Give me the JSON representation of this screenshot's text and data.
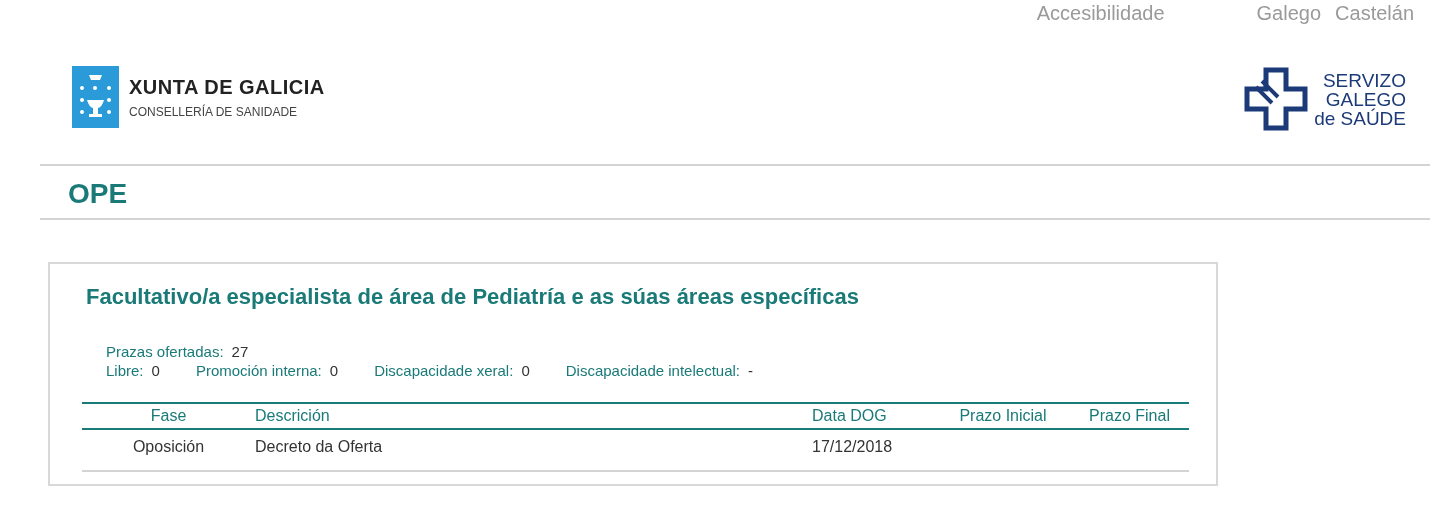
{
  "top_links": [
    {
      "label": "Accesibilidade"
    },
    {
      "label": "Galego"
    },
    {
      "label": "Castelán"
    }
  ],
  "logo_left": {
    "title": "XUNTA DE GALICIA",
    "subtitle": "CONSELLERÍA DE SANIDADE"
  },
  "logo_right": {
    "lines": [
      "SERVIZO",
      "GALEGO",
      "de SAÚDE"
    ]
  },
  "page_title": "OPE",
  "card": {
    "title": "Facultativo/a especialista de área de Pediatría e as súas áreas específicas",
    "summary": [
      {
        "label": "Prazas ofertadas:",
        "value": "27"
      }
    ],
    "counts": [
      {
        "label": "Libre:",
        "value": "0"
      },
      {
        "label": "Promoción interna:",
        "value": "0"
      },
      {
        "label": "Discapacidade xeral:",
        "value": "0"
      },
      {
        "label": "Discapacidade intelectual:",
        "value": "-"
      }
    ],
    "table": {
      "columns": [
        "Fase",
        "Descrición",
        "Data DOG",
        "Prazo Inicial",
        "Prazo Final"
      ],
      "rows": [
        {
          "cells": [
            "Oposición",
            "Decreto da Oferta",
            "17/12/2018"
          ]
        }
      ]
    }
  }
}
